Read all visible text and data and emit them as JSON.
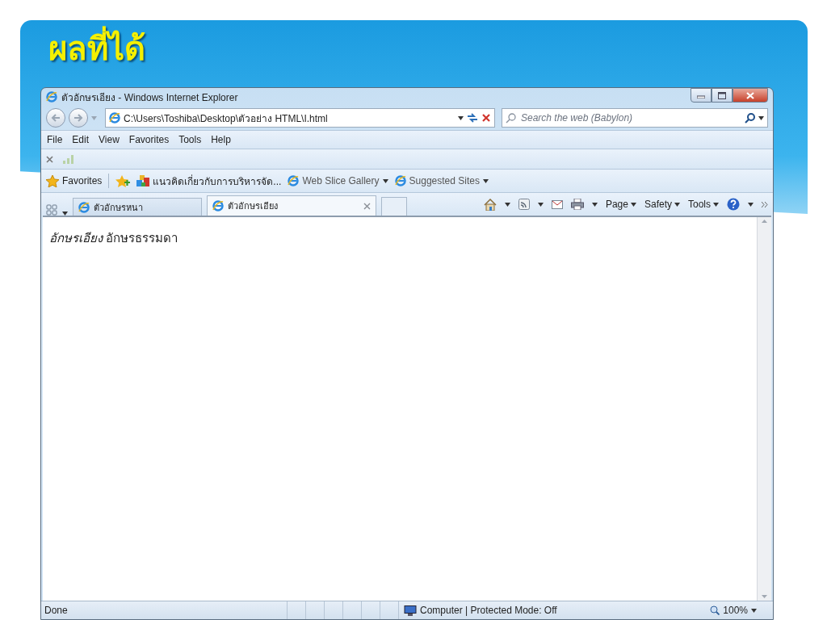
{
  "slide": {
    "title": "ผลที่ได้"
  },
  "window": {
    "title": "ตัวอักษรเอียง - Windows Internet Explorer"
  },
  "address_bar": {
    "value": "C:\\Users\\Toshiba\\Desktop\\ตัวอย่าง HTML\\I.html"
  },
  "search": {
    "placeholder": "Search the web (Babylon)"
  },
  "menu": [
    "File",
    "Edit",
    "View",
    "Favorites",
    "Tools",
    "Help"
  ],
  "favorites_bar": {
    "label": "Favorites",
    "links": [
      {
        "label": "แนวคิดเกี่ยวกับการบริหารจัด...",
        "kind": "site"
      },
      {
        "label": "Web Slice Gallery",
        "kind": "menu"
      },
      {
        "label": "Suggested Sites",
        "kind": "menu"
      }
    ]
  },
  "tabs": [
    {
      "label": "ตัวอักษรหนา",
      "selected": false
    },
    {
      "label": "ตัวอักษรเอียง",
      "selected": true
    }
  ],
  "command_bar": [
    "Page",
    "Safety",
    "Tools"
  ],
  "content": {
    "text": "*อักษรเอียง* อักษรธรรมดา"
  },
  "status_bar": {
    "status": "Done",
    "zone": "Computer | Protected Mode: Off",
    "zoom": "100%"
  }
}
